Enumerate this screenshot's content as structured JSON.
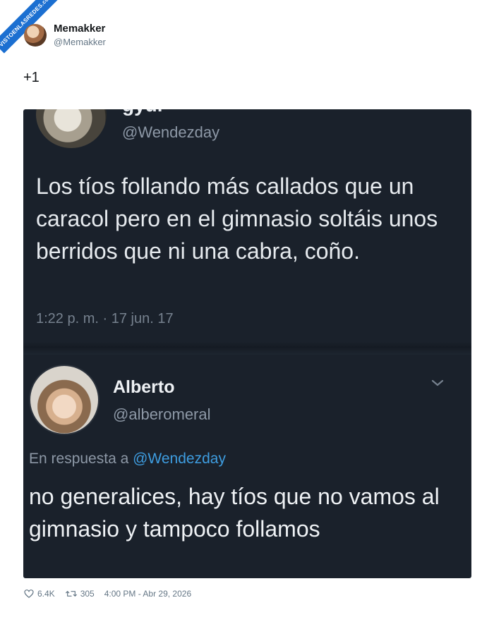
{
  "watermark": "VISTOENLASREDES.com",
  "author": {
    "name": "Memakker",
    "handle": "@Memakker"
  },
  "tweet": {
    "text": "+1"
  },
  "screenshot": {
    "quoted": {
      "name_cut": "gyur",
      "handle": "@Wendezday",
      "text": "Los tíos follando más callados que un caracol pero en el gimnasio soltáis unos berridos que ni una cabra, coño.",
      "time": "1:22 p. m. · 17 jun. 17"
    },
    "reply": {
      "name": "Alberto",
      "handle": "@alberomeral",
      "reply_prefix": "En respuesta a",
      "reply_mention": "@Wendezday",
      "text": "no generalices, hay tíos que no vamos al gimnasio y tampoco follamos"
    }
  },
  "stats": {
    "likes": "6.4K",
    "retweets": "305",
    "timestamp": "4:00 PM - Abr 29, 2026"
  },
  "icons": {
    "like": "heart-icon",
    "retweet": "retweet-icon",
    "menu": "chevron-down-icon"
  }
}
